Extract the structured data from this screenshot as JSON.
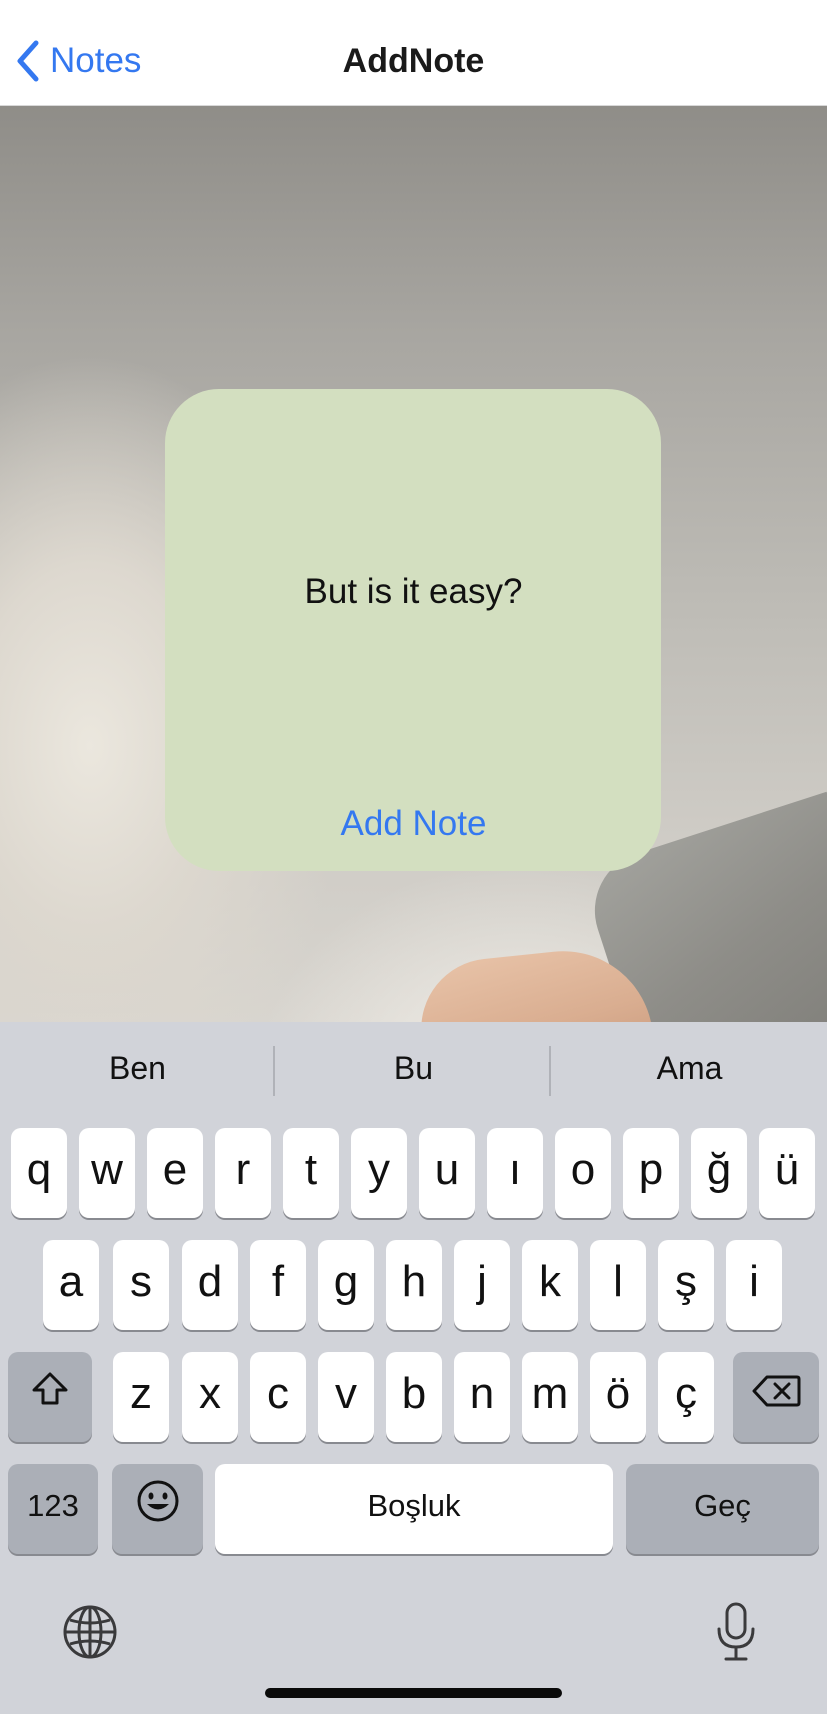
{
  "navbar": {
    "back_label": "Notes",
    "title": "AddNote"
  },
  "note": {
    "text": "But is it easy?",
    "add_button_label": "Add Note",
    "card_color": "#d3dfc0"
  },
  "keyboard": {
    "suggestions": [
      "Ben",
      "Bu",
      "Ama"
    ],
    "row1": [
      "q",
      "w",
      "e",
      "r",
      "t",
      "y",
      "u",
      "ı",
      "o",
      "p",
      "ğ",
      "ü"
    ],
    "row2": [
      "a",
      "s",
      "d",
      "f",
      "g",
      "h",
      "j",
      "k",
      "l",
      "ş",
      "i"
    ],
    "row3": [
      "z",
      "x",
      "c",
      "v",
      "b",
      "n",
      "m",
      "ö",
      "ç"
    ],
    "numbers_label": "123",
    "space_label": "Boşluk",
    "return_label": "Geç",
    "icons": {
      "shift": "shift-icon",
      "backspace": "backspace-icon",
      "emoji": "emoji-icon",
      "globe": "globe-icon",
      "mic": "microphone-icon"
    }
  },
  "colors": {
    "accent": "#3478f0",
    "keyboard_bg": "#d1d3d9",
    "dark_key": "#abafb7"
  }
}
